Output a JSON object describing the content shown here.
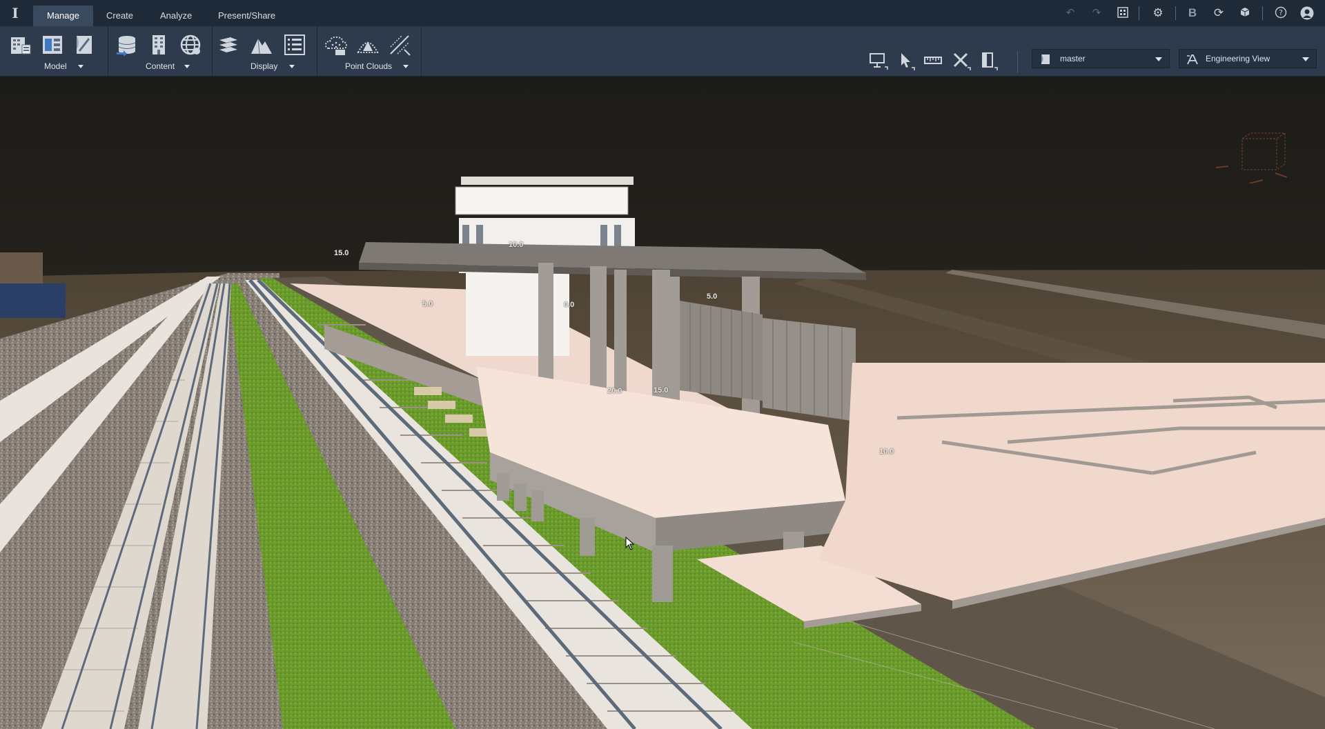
{
  "app": {
    "logo": "I"
  },
  "tabs": [
    {
      "label": "Manage",
      "active": true
    },
    {
      "label": "Create",
      "active": false
    },
    {
      "label": "Analyze",
      "active": false
    },
    {
      "label": "Present/Share",
      "active": false
    }
  ],
  "top_right_icons": [
    "undo-icon",
    "redo-icon",
    "layout-icon",
    "gear-icon",
    "bold-b-icon",
    "refresh-icon",
    "cube-cloud-icon",
    "help-icon",
    "user-avatar-icon"
  ],
  "ribbon": {
    "groups": [
      {
        "label": "Model",
        "icons": [
          "building-icon",
          "model-panel-icon",
          "sketch-icon"
        ]
      },
      {
        "label": "Content",
        "icons": [
          "database-import-icon",
          "building-grid-icon",
          "globe-network-icon"
        ]
      },
      {
        "label": "Display",
        "icons": [
          "layers-icon",
          "terrain-icon",
          "list-icon"
        ]
      },
      {
        "label": "Point Clouds",
        "icons": [
          "cloud-points-icon",
          "dome-points-icon",
          "slice-icon"
        ]
      }
    ],
    "right_tools": [
      "monitor-icon",
      "select-arrow-icon",
      "measure-icon",
      "cross-tools-icon",
      "section-icon"
    ],
    "branch_selector": {
      "value": "master",
      "icon": "branch-icon"
    },
    "view_selector": {
      "value": "Engineering View",
      "icon": "view-style-icon"
    }
  },
  "viewport": {
    "dimension_labels": [
      "10.0",
      "15.0",
      "5.0",
      "0.0",
      "5.0",
      "20.0",
      "15.0",
      "10.0"
    ],
    "colors": {
      "sky": "#1e1c18",
      "ballast": "#8a8278",
      "grass": "#6a9a2c",
      "platform": "#f3ddd2",
      "concrete": "#9b9490",
      "terrain": "#6b5c4a"
    }
  }
}
